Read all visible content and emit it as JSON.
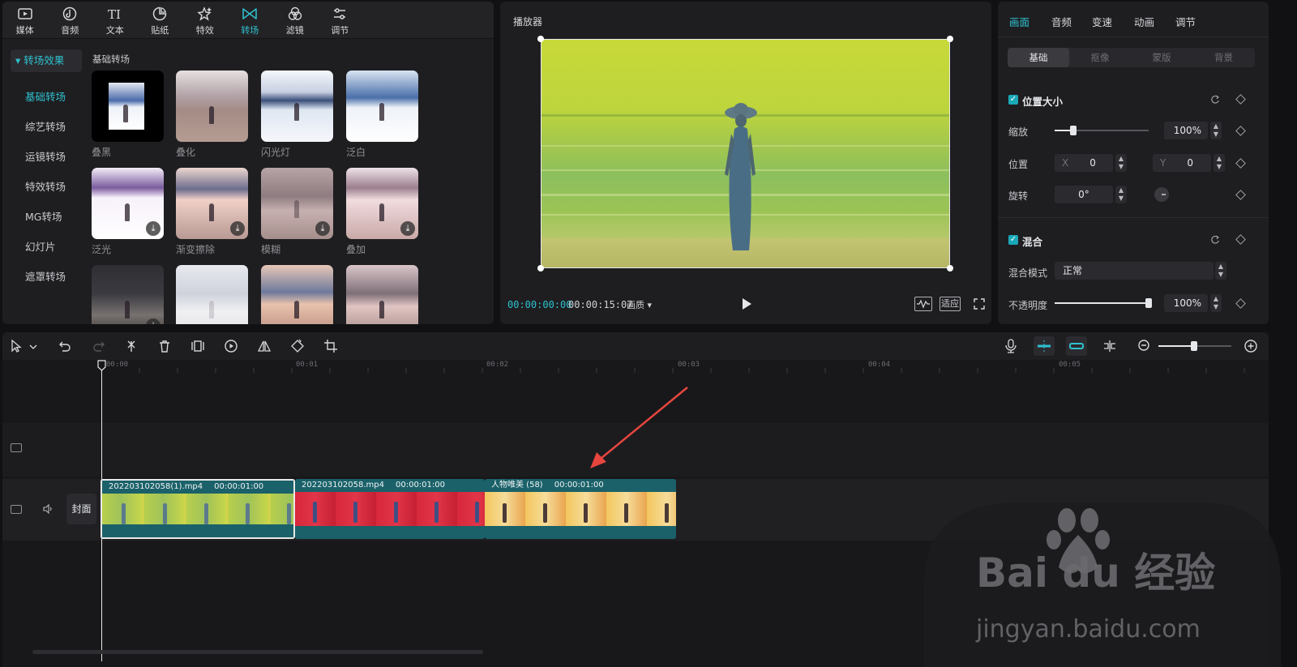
{
  "nav": {
    "items": [
      {
        "label": "媒体",
        "icon": "media-icon"
      },
      {
        "label": "音频",
        "icon": "audio-icon"
      },
      {
        "label": "文本",
        "icon": "text-icon"
      },
      {
        "label": "贴纸",
        "icon": "sticker-icon"
      },
      {
        "label": "特效",
        "icon": "effects-icon"
      },
      {
        "label": "转场",
        "icon": "transition-icon",
        "active": true
      },
      {
        "label": "滤镜",
        "icon": "filter-icon"
      },
      {
        "label": "调节",
        "icon": "adjust-icon"
      }
    ]
  },
  "categories": {
    "header": "转场效果",
    "items": [
      "基础转场",
      "综艺转场",
      "运镜转场",
      "特效转场",
      "MG转场",
      "幻灯片",
      "遮罩转场"
    ],
    "active_index": 0
  },
  "section_title": "基础转场",
  "transitions": [
    {
      "name": "叠黑"
    },
    {
      "name": "叠化"
    },
    {
      "name": "闪光灯"
    },
    {
      "name": "泛白"
    },
    {
      "name": "泛光",
      "download": true
    },
    {
      "name": "渐变擦除",
      "download": true
    },
    {
      "name": "模糊",
      "download": true
    },
    {
      "name": "叠加",
      "download": true
    },
    {
      "name": "",
      "download": true
    },
    {
      "name": ""
    },
    {
      "name": ""
    },
    {
      "name": ""
    }
  ],
  "player": {
    "title": "播放器",
    "current_time": "00:00:00:00",
    "total_time": "00:00:15:07",
    "quality": "画质",
    "fit_label": "适应"
  },
  "props": {
    "tabs": [
      "画面",
      "音频",
      "变速",
      "动画",
      "调节"
    ],
    "active_tab": 0,
    "subtabs": [
      "基础",
      "抠像",
      "蒙版",
      "背景"
    ],
    "active_subtab": 0,
    "position_size": {
      "title": "位置大小",
      "scale_label": "缩放",
      "scale_value": "100%",
      "scale_fraction": 0.2,
      "position_label": "位置",
      "x_label": "X",
      "x_value": "0",
      "y_label": "Y",
      "y_value": "0",
      "rotation_label": "旋转",
      "rotation_value": "0°"
    },
    "blend": {
      "title": "混合",
      "mode_label": "混合模式",
      "mode_value": "正常",
      "opacity_label": "不透明度",
      "opacity_value": "100%",
      "opacity_fraction": 1.0
    }
  },
  "timeline": {
    "ticks": [
      "00:00",
      "00:01",
      "00:02",
      "00:03",
      "00:04",
      "00:05"
    ],
    "cover_label": "封面",
    "clips": [
      {
        "name": "202203102058(1).mp4",
        "duration": "00:00:01:00"
      },
      {
        "name": "202203102058.mp4",
        "duration": "00:00:01:00"
      },
      {
        "name": "人物唯美 (58)",
        "duration": "00:00:01:00"
      }
    ]
  },
  "watermark": {
    "brand": "Bai du 经验",
    "url": "jingyan.baidu.com"
  },
  "colors": {
    "accent": "#2fc1cf",
    "clip_header": "#1b6169"
  }
}
